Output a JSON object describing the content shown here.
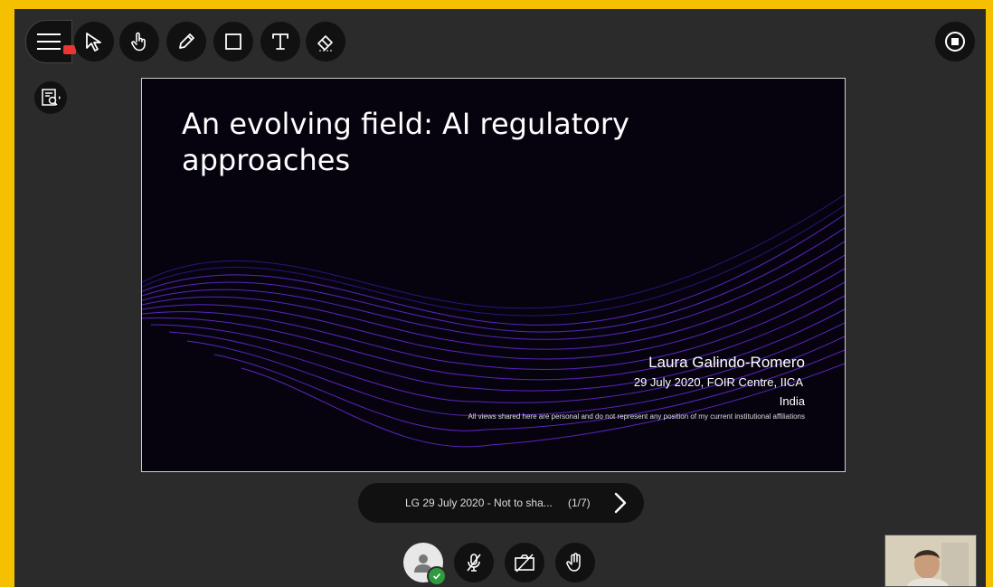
{
  "toolbar": {
    "tools": [
      {
        "name": "select",
        "icon": "pointer-arrow-icon"
      },
      {
        "name": "pan",
        "icon": "hand-icon"
      },
      {
        "name": "pen",
        "icon": "pencil-icon"
      },
      {
        "name": "rectangle",
        "icon": "square-icon"
      },
      {
        "name": "text",
        "icon": "text-icon"
      },
      {
        "name": "eraser",
        "icon": "eraser-icon"
      }
    ],
    "recording_color": "#e33333"
  },
  "slide": {
    "title": "An evolving field: AI regulatory approaches",
    "author": "Laura Galindo-Romero",
    "date_line": "29 July 2020, FOIR Centre, IICA",
    "country": "India",
    "disclaimer": "All views shared here are personal and do not represent any position of my current institutional affiliations"
  },
  "navigator": {
    "document_name": "LG 29 July 2020 - Not to sha...",
    "page_indicator": "(1/7)"
  },
  "colors": {
    "frame": "#f5c000",
    "background": "#2b2b2b",
    "slide_bg": "#06030f",
    "wave": "#6a2bd9",
    "status_ok": "#2e9b3e"
  }
}
